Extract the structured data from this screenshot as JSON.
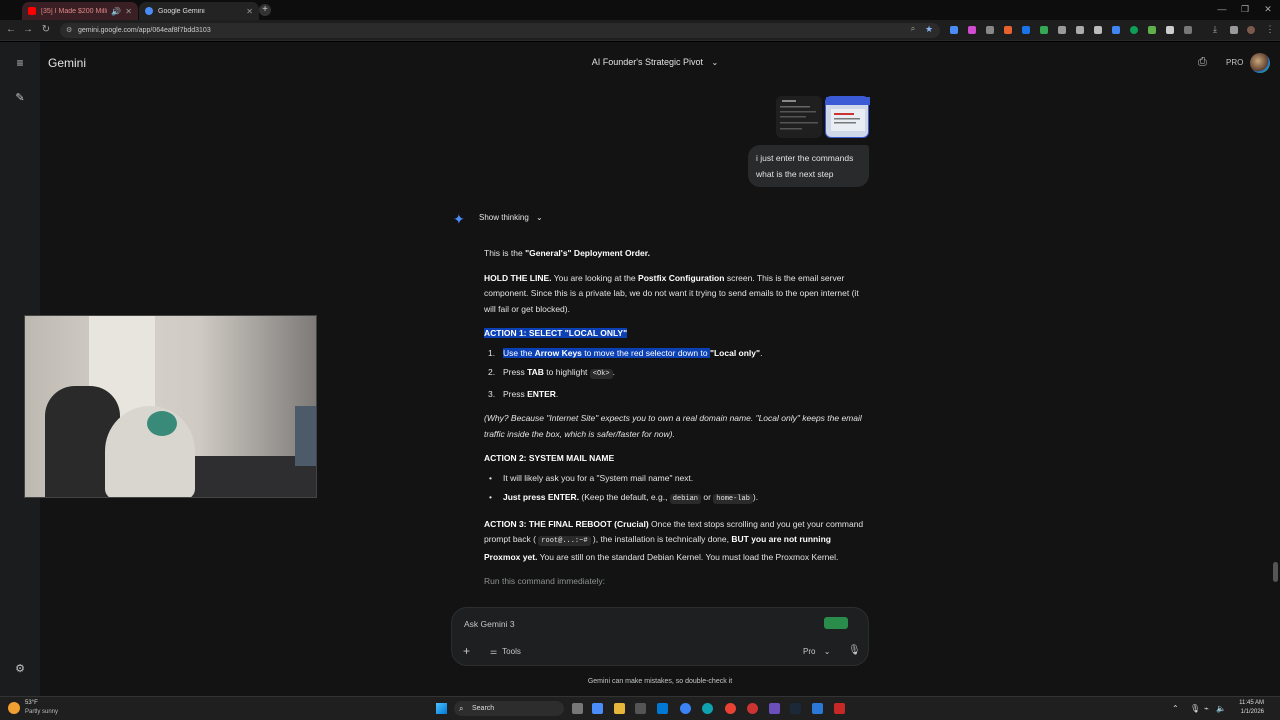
{
  "browser": {
    "tabs": [
      {
        "label": "[35] I Made $200 Million AI...",
        "active": false,
        "color": "#ff0000"
      },
      {
        "label": "Google Gemini",
        "active": true,
        "color": "#4b8df8"
      }
    ],
    "url": "gemini.google.com/app/064eaf8f7bdd3103",
    "new_tab": "+",
    "window_min": "—",
    "window_max": "❐",
    "window_close": "✕"
  },
  "app": {
    "brand": "Gemini",
    "conversation_title": "AI Founder's Strategic Pivot",
    "plan_badge": "PRO"
  },
  "user_message": {
    "text": "i just enter the commands what is the next step"
  },
  "response": {
    "show_thinking": "Show thinking",
    "intro_pre": "This is the ",
    "intro_bold": "\"General's\" Deployment Order.",
    "hold_bold": "HOLD THE LINE.",
    "hold_text_1": " You are looking at the ",
    "hold_bold_2": "Postfix Configuration",
    "hold_text_2": " screen. This is the email server component. Since this is a private lab, we do not want it trying to send emails to the open internet (it will fail or get blocked).",
    "action1_title": "ACTION 1: SELECT \"LOCAL ONLY\"",
    "action1_steps": [
      {
        "num": "1.",
        "pre": "Use the ",
        "bold": "Arrow Keys",
        "post": " to move the red selector down to ",
        "bold2": "\"Local only\"",
        "end": "."
      },
      {
        "num": "2.",
        "pre": "Press ",
        "bold": "TAB",
        "post": " to highlight ",
        "code": "<Ok>",
        "end": "."
      },
      {
        "num": "3.",
        "pre": "Press ",
        "bold": "ENTER",
        "end": "."
      }
    ],
    "why_text": "(Why? Because \"Internet Site\" expects you to own a real domain name. \"Local only\" keeps the email traffic inside the box, which is safer/faster for now).",
    "action2_title": "ACTION 2: SYSTEM MAIL NAME",
    "action2_bullets": [
      {
        "text": "It will likely ask you for a \"System mail name\" next."
      },
      {
        "bold": "Just press ENTER.",
        "text": " (Keep the default, e.g., ",
        "code1": "debian",
        "mid": " or ",
        "code2": "home-lab",
        "end": ")."
      }
    ],
    "action3_title": "ACTION 3: THE FINAL REBOOT (Crucial)",
    "action3_text_1": " Once the text stops scrolling and you get your command prompt back ( ",
    "action3_code": "root@...:~#",
    "action3_text_2": " ), the installation is technically done, ",
    "action3_bold": "BUT you are not running Proxmox yet.",
    "action3_text_3": " You are still on the standard Debian Kernel. You must load the Proxmox Kernel.",
    "run_text": "Run this command immediately:"
  },
  "input": {
    "placeholder": "Ask Gemini 3",
    "tools_label": "Tools",
    "mode_label": "Pro",
    "add_icon": "+",
    "disclaimer": "Gemini can make mistakes, so double-check it"
  },
  "taskbar": {
    "weather_temp": "53°F",
    "weather_desc": "Partly sunny",
    "search_label": "Search",
    "time": "11:45 AM",
    "date": "1/1/2026"
  },
  "colors": {
    "highlight": "#0b41b4",
    "gemini_blue": "#4b8df8",
    "background": "#131314"
  }
}
